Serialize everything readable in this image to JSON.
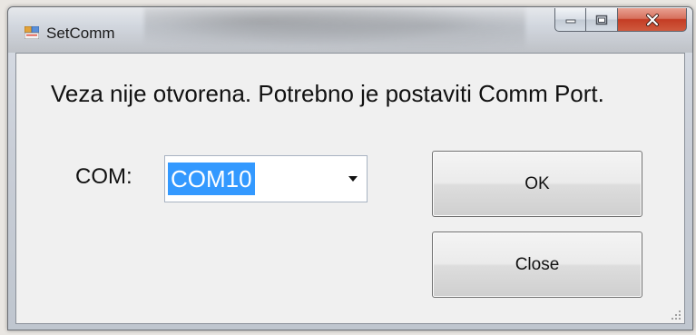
{
  "window": {
    "title": "SetComm"
  },
  "dialog": {
    "message": "Veza nije otvorena. Potrebno je postaviti Comm Port.",
    "com_label": "COM:",
    "com_select": {
      "selected": "COM10"
    },
    "ok_label": "OK",
    "close_label": "Close"
  },
  "colors": {
    "selection_highlight": "#3399ff",
    "close_caption_button": "#c43c24"
  },
  "icons": {
    "app": "form-window-icon",
    "minimize": "minimize-icon",
    "maximize": "maximize-icon",
    "close": "close-icon",
    "dropdown": "chevron-down-icon",
    "resize": "resize-grip-icon"
  }
}
